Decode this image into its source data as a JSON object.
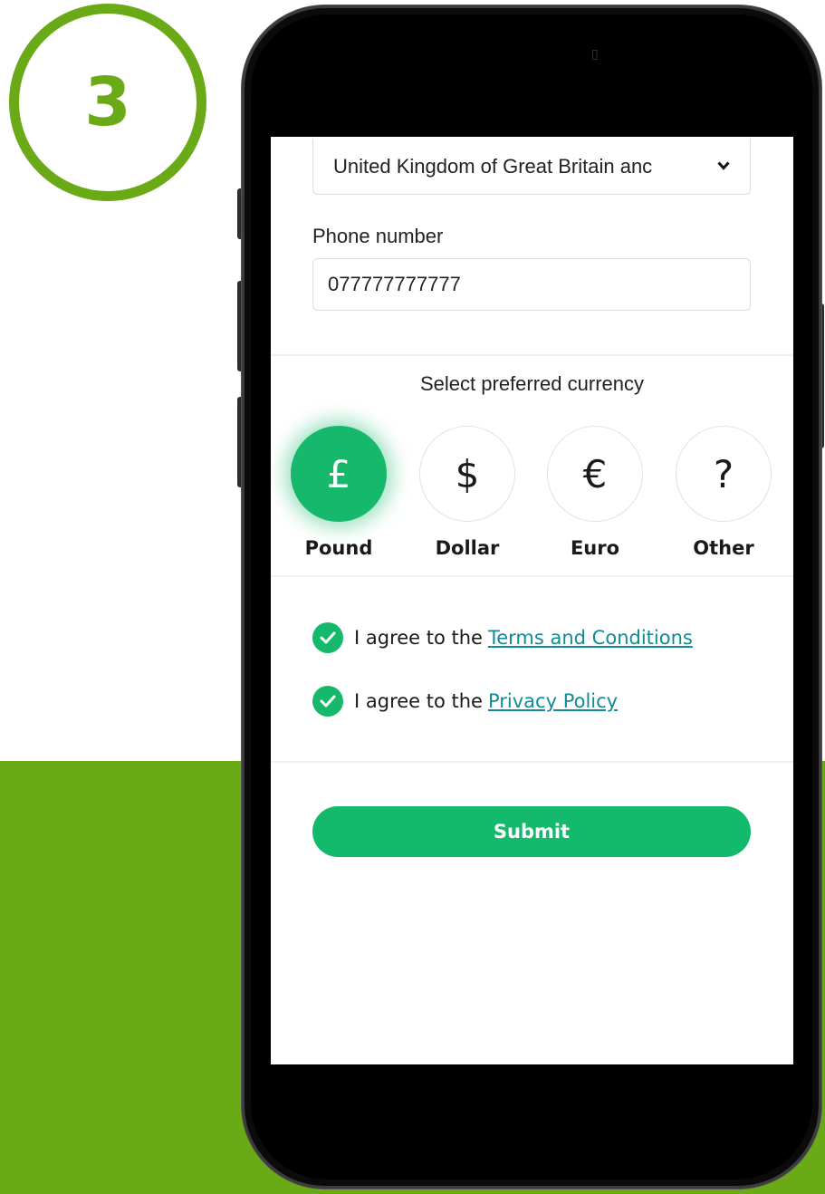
{
  "step": {
    "number": "3"
  },
  "form": {
    "country_value": "United Kingdom of Great Britain anc",
    "phone_label": "Phone number",
    "phone_value": "077777777777",
    "currency_title": "Select preferred currency",
    "currencies": [
      {
        "symbol": "£",
        "label": "Pound",
        "selected": true
      },
      {
        "symbol": "$",
        "label": "Dollar",
        "selected": false
      },
      {
        "symbol": "€",
        "label": "Euro",
        "selected": false
      },
      {
        "symbol": "?",
        "label": "Other",
        "selected": false
      }
    ],
    "agreements": [
      {
        "prefix": "I agree to the",
        "link": "Terms and Conditions",
        "checked": true
      },
      {
        "prefix": "I agree to the",
        "link": "Privacy Policy",
        "checked": true
      }
    ],
    "submit_label": "Submit"
  },
  "colors": {
    "brand_green": "#6aaa16",
    "accent_green": "#16b96b",
    "link": "#138a94"
  },
  "icons": {
    "select": "chevron-down-icon",
    "check": "checkmark-icon",
    "camera": "front-camera-icon"
  }
}
